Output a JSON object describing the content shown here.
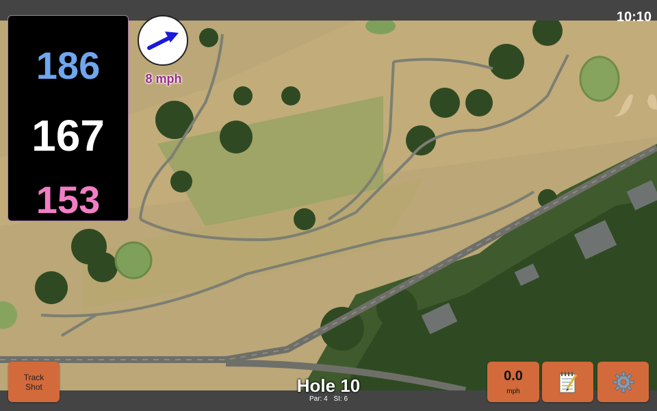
{
  "status_bar": {
    "time": "10:10"
  },
  "distances": {
    "back": "186",
    "middle": "167",
    "front": "153"
  },
  "wind": {
    "speed": "8 mph",
    "direction_icon": "arrow-icon"
  },
  "buttons": {
    "track_shot": {
      "line1": "Track",
      "line2": "Shot"
    },
    "speed": {
      "value": "0.0",
      "unit": "mph"
    },
    "notes_icon": "notepad-icon",
    "settings_icon": "gear-icon"
  },
  "hole": {
    "title": "Hole 10",
    "par": "Par: 4",
    "si": "SI: 6"
  },
  "colors": {
    "back": "#6fa6ee",
    "middle": "#ffffff",
    "front": "#f17ec4",
    "button": "#d26a3b",
    "wind_text": "#9b2a8a"
  }
}
